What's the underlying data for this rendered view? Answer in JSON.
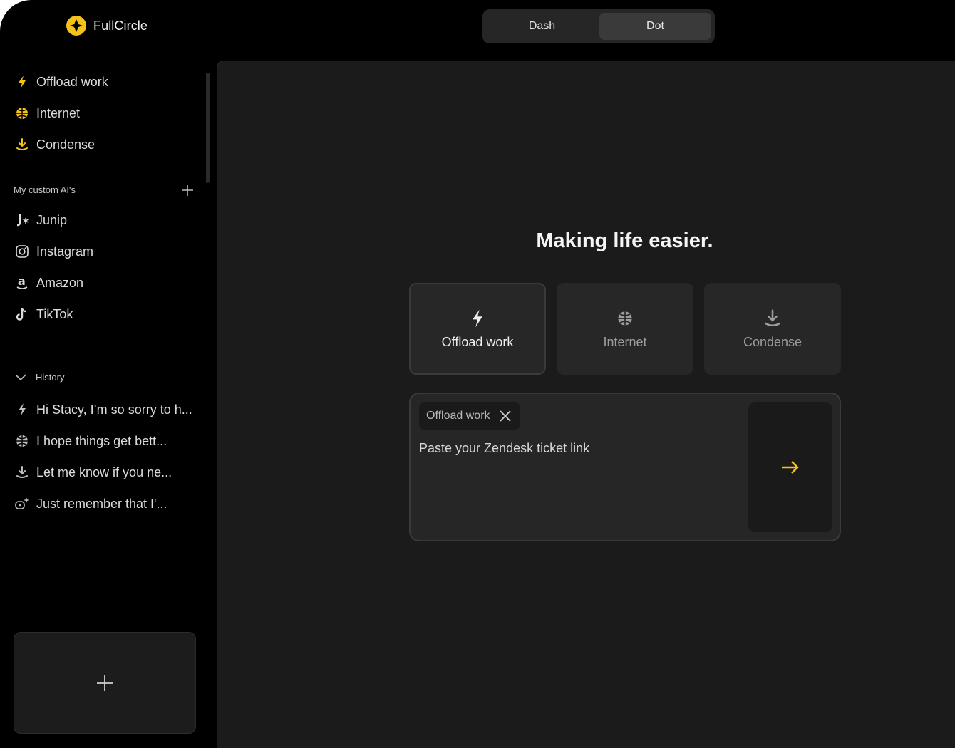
{
  "app": {
    "name": "FullCircle"
  },
  "colors": {
    "accent": "#f5c21b",
    "background": "#000000",
    "panel": "#1b1b1b",
    "card": "#272727"
  },
  "view_toggle": {
    "options": [
      "Dash",
      "Dot"
    ],
    "selected": "Dot"
  },
  "sidebar": {
    "primary_items": [
      {
        "label": "Offload work",
        "icon": "lightning-icon"
      },
      {
        "label": "Internet",
        "icon": "globe-icon"
      },
      {
        "label": "Condense",
        "icon": "download-icon"
      }
    ],
    "custom_section_label": "My custom AI's",
    "custom_items": [
      {
        "label": "Junip",
        "icon": "junip-logo-icon"
      },
      {
        "label": "Instagram",
        "icon": "instagram-icon"
      },
      {
        "label": "Amazon",
        "icon": "amazon-icon"
      },
      {
        "label": "TikTok",
        "icon": "tiktok-icon"
      }
    ],
    "history_label": "History",
    "history_items": [
      {
        "label": "Hi Stacy, I’m so sorry to h...",
        "icon": "lightning-icon"
      },
      {
        "label": "I hope things get bett...",
        "icon": "globe-icon"
      },
      {
        "label": "Let me know if you ne...",
        "icon": "download-icon"
      },
      {
        "label": "Just remember that I'...",
        "icon": "custom-ai-icon"
      }
    ]
  },
  "main": {
    "headline": "Making life easier.",
    "modes": [
      {
        "label": "Offload work",
        "icon": "lightning-icon",
        "selected": true
      },
      {
        "label": "Internet",
        "icon": "globe-icon",
        "selected": false
      },
      {
        "label": "Condense",
        "icon": "download-icon",
        "selected": false
      }
    ],
    "composer": {
      "chip_label": "Offload work",
      "prompt": "Paste your Zendesk ticket link"
    }
  }
}
